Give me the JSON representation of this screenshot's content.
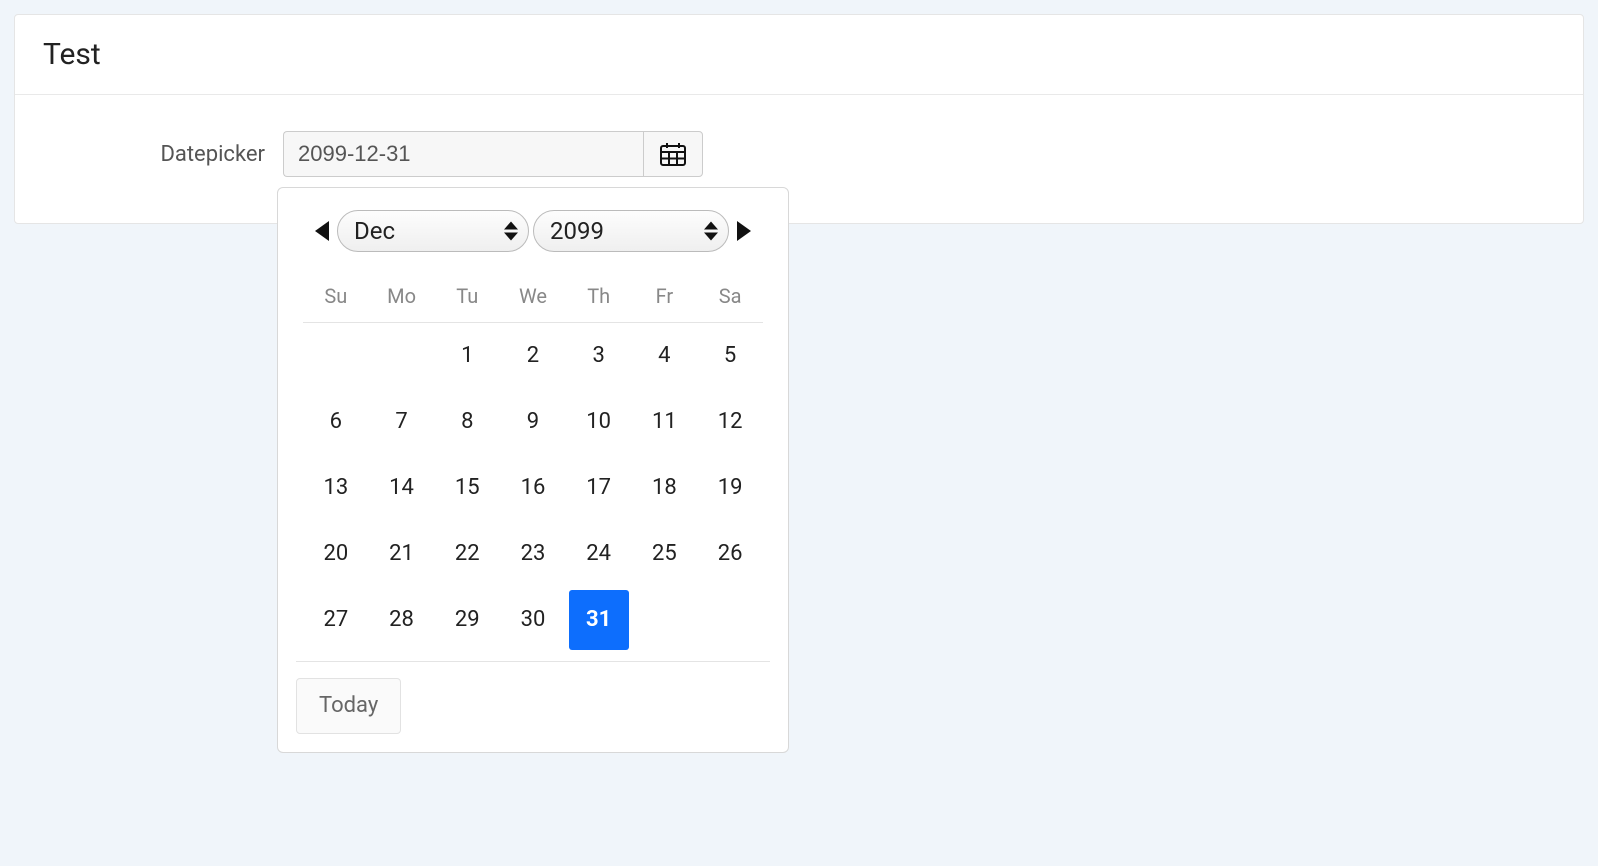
{
  "panel": {
    "title": "Test",
    "field_label": "Datepicker",
    "date_value": "2099-12-31"
  },
  "picker": {
    "month_label": "Dec",
    "year_label": "2099",
    "weekday_labels": [
      "Su",
      "Mo",
      "Tu",
      "We",
      "Th",
      "Fr",
      "Sa"
    ],
    "weeks": [
      [
        "",
        "",
        "1",
        "2",
        "3",
        "4",
        "5"
      ],
      [
        "6",
        "7",
        "8",
        "9",
        "10",
        "11",
        "12"
      ],
      [
        "13",
        "14",
        "15",
        "16",
        "17",
        "18",
        "19"
      ],
      [
        "20",
        "21",
        "22",
        "23",
        "24",
        "25",
        "26"
      ],
      [
        "27",
        "28",
        "29",
        "30",
        "31",
        "",
        ""
      ]
    ],
    "selected_day": "31",
    "today_label": "Today"
  }
}
